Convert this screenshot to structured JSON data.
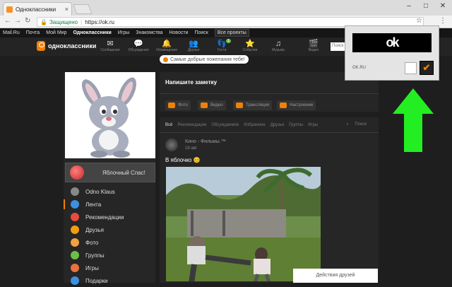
{
  "browser": {
    "tab_title": "Одноклассники",
    "tab_close": "×",
    "secure_label": "Защищено",
    "url": "https://ok.ru",
    "ext_ok_badge": "OK",
    "window_min": "–",
    "window_max": "□",
    "window_close": "✕"
  },
  "portal_nav": {
    "items": [
      "Mail.Ru",
      "Почта",
      "Мой Мир",
      "Одноклассники",
      "Игры",
      "Знакомства",
      "Новости",
      "Поиск"
    ],
    "all_projects": "Все проекты"
  },
  "ok_header": {
    "logo_text": "одноклассники",
    "nav": [
      {
        "icon": "envelope-icon",
        "label": "Сообщения"
      },
      {
        "icon": "chat-icon",
        "label": "Обсуждения"
      },
      {
        "icon": "bell-icon",
        "label": "Оповещения"
      },
      {
        "icon": "friends-icon",
        "label": "Друзья"
      },
      {
        "icon": "guests-icon",
        "label": "Гости",
        "badge": "1"
      },
      {
        "icon": "events-icon",
        "label": "События"
      },
      {
        "icon": "music-icon",
        "label": "Музыка"
      },
      {
        "icon": "video-icon",
        "label": "Видео"
      }
    ],
    "search_placeholder": "Поиск"
  },
  "wish_banner": "Самые добрые пожелания тебе!",
  "profile": {
    "banner_text": "Яблочный Спас!",
    "menu": [
      {
        "label": "Odno Klaus",
        "color": "#888888"
      },
      {
        "label": "Лента",
        "color": "#3d8fdf",
        "active": true
      },
      {
        "label": "Рекомендации",
        "color": "#e74c3c"
      },
      {
        "label": "Друзья",
        "color": "#f39c12"
      },
      {
        "label": "Фото",
        "color": "#f1a23a"
      },
      {
        "label": "Группы",
        "color": "#6cbe45"
      },
      {
        "label": "Игры",
        "color": "#e8743b"
      },
      {
        "label": "Подарки",
        "color": "#3d8fdf"
      }
    ]
  },
  "composer": {
    "prompt": "Напишите заметку",
    "buttons": [
      "Фото",
      "Видео",
      "Трансляция",
      "Настроение"
    ]
  },
  "feed": {
    "tabs": [
      "Всё",
      "Рекомендации",
      "Обсуждаемое",
      "Избранное",
      "Друзья",
      "Группы",
      "Игры"
    ],
    "search_label": "Поиск",
    "post": {
      "author": "Кино - Фильмы.™",
      "date": "18 авг",
      "text": "В яблочко 😊"
    }
  },
  "friends_actions": "Действия друзей",
  "extension_popup": {
    "logo_text": "ok",
    "site_label": "OK.RU",
    "check_mark": "✔"
  },
  "colors": {
    "accent": "#ee8208",
    "arrow": "#22ee22",
    "background": "#1e1e1e"
  }
}
